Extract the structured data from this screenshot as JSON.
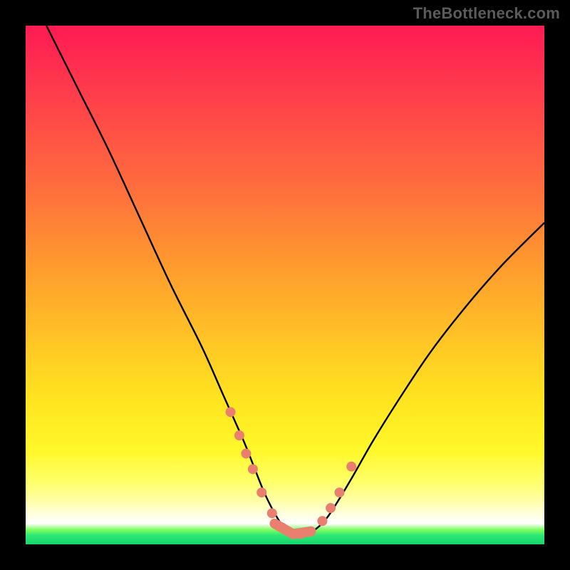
{
  "watermark": "TheBottleneck.com",
  "chart_data": {
    "type": "line",
    "title": "",
    "xlabel": "",
    "ylabel": "",
    "xlim": [
      0,
      100
    ],
    "ylim": [
      0,
      100
    ],
    "grid": false,
    "legend": false,
    "series": [
      {
        "name": "bottleneck-curve",
        "x": [
          4,
          10,
          16,
          22,
          28,
          34,
          38,
          42,
          44,
          46,
          48,
          50,
          52,
          54,
          56,
          58,
          60,
          63,
          67,
          72,
          78,
          85,
          92,
          100
        ],
        "y": [
          100,
          88,
          76,
          63,
          50,
          38,
          29,
          20,
          15,
          10,
          6,
          3,
          2,
          2,
          3,
          5,
          8,
          13,
          20,
          28,
          37,
          46,
          54,
          62
        ]
      }
    ],
    "markers": {
      "name": "highlighted-points",
      "color": "#e9806f",
      "x": [
        39.5,
        41.2,
        42.5,
        43.8,
        45.5,
        47.5,
        49.5,
        51.5,
        53.0,
        55.0,
        57.2,
        58.8,
        60.5,
        62.8
      ],
      "y": [
        25.5,
        21.0,
        17.5,
        14.5,
        10.0,
        6.0,
        3.2,
        2.0,
        2.0,
        2.5,
        4.5,
        7.0,
        10.0,
        15.0
      ]
    },
    "marker_pills": {
      "name": "highlighted-pills",
      "color": "#e9806f",
      "segments": [
        {
          "x0": 48.0,
          "y0": 4.0,
          "x1": 51.5,
          "y1": 2.0
        },
        {
          "x0": 51.5,
          "y0": 2.0,
          "x1": 55.0,
          "y1": 2.5
        }
      ]
    }
  },
  "colors": {
    "curve": "#000000",
    "marker": "#e9806f",
    "frame": "#000000"
  }
}
